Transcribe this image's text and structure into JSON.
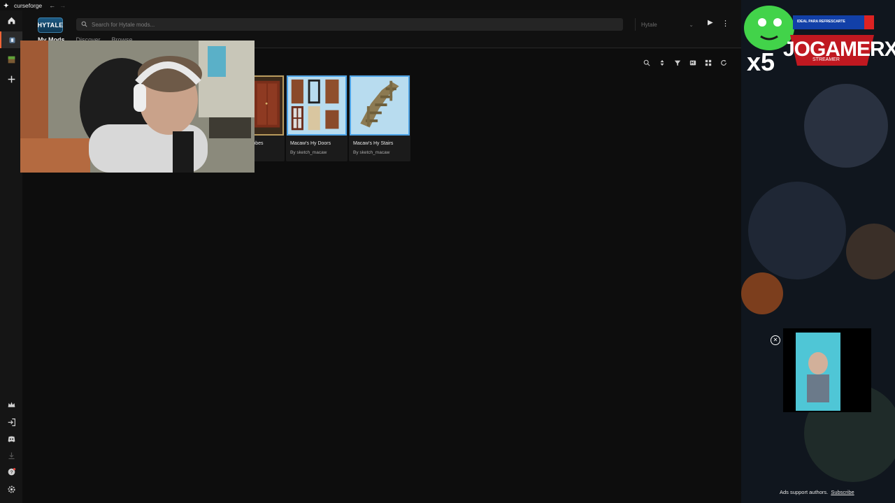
{
  "titlebar": {
    "app_name": "curseforge",
    "back": "←",
    "forward": "→",
    "controls": [
      "▤",
      "–",
      "❐",
      "✕"
    ]
  },
  "header": {
    "logo_text": "HYTALE",
    "search_placeholder": "Search for Hytale mods...",
    "game_select": "Hytale",
    "tabs": [
      "My Mods",
      "Discover",
      "Browse"
    ]
  },
  "mods": [
    {
      "name": "Macaw's Hy Wardrobes",
      "visible_name": "robes",
      "author": ""
    },
    {
      "name": "Macaw's Hy Doors",
      "author": "By sketch_macaw"
    },
    {
      "name": "Macaw's Hy Stairs",
      "author": "By sketch_macaw"
    }
  ],
  "overlay": {
    "brand": "JOGAMERX",
    "brand_sub": "STREAMER",
    "multiplier": "x5",
    "ad_banner": "IDEAL PARA REFRESCARTE",
    "ad_footer_text": "Ads support authors.",
    "ad_footer_link": "Subscribe"
  },
  "colors": {
    "accent": "#f16436",
    "card_border": "#4da3e6",
    "background": "#0d0d0d"
  }
}
